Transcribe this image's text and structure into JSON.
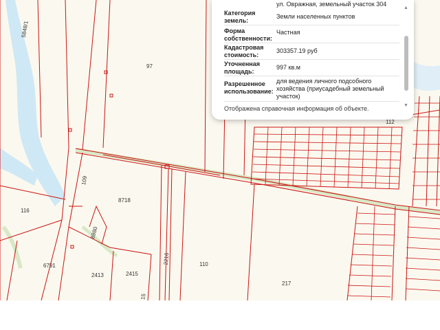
{
  "popup": {
    "address_partial": "ул. Овражная, земельный участок 304",
    "rows": [
      {
        "key": "Категория земель:",
        "value": "Земли населенных пунктов"
      },
      {
        "key": "Форма собственности:",
        "value": "Частная"
      },
      {
        "key": "Кадастровая стоимость:",
        "value": "303357.19 руб"
      },
      {
        "key": "Уточненная площадь:",
        "value": "997 кв.м"
      },
      {
        "key": "Разрешенное использование:",
        "value": "для ведения личного подсобного хозяйства (приусадебный земельный участок)"
      }
    ],
    "footer": "Отображена справочная информация об объекте."
  },
  "map": {
    "labels": [
      "5848/1",
      "97",
      "116",
      "8718",
      "6791",
      "2413",
      "2415",
      "2216",
      "110",
      "217",
      "109",
      "8980",
      "112",
      "15"
    ]
  },
  "colors": {
    "boundary": "#cc1111",
    "water": "#cfe8f5",
    "map_bg": "#fbf9ef",
    "road": "#d9e8c6"
  }
}
